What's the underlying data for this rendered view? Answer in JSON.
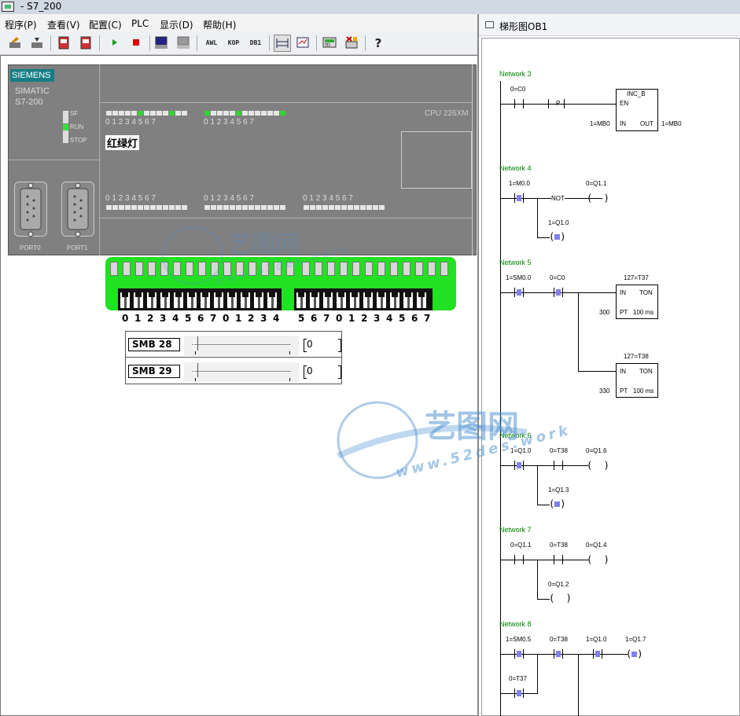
{
  "window": {
    "title": "- S7_200"
  },
  "menu": [
    "程序(P)",
    "查看(V)",
    "配置(C)",
    "PLC",
    "显示(D)",
    "帮助(H)"
  ],
  "toolbar": {
    "awl": "AWL",
    "kop": "KOP",
    "db1": "DB1",
    "help": "?"
  },
  "plc": {
    "brand": "SIEMENS",
    "line1": "SIMATIC",
    "line2": "S7-200",
    "status": [
      "SF",
      "RUN",
      "STOP"
    ],
    "cpu": "CPU 226XM",
    "label": "红绿灯",
    "digits": "0 1 2 3 4 5 6 7",
    "ports": [
      "PORT0",
      "PORT1"
    ]
  },
  "terminal_numbers": [
    "0",
    "1",
    "2",
    "3",
    "4",
    "5",
    "6",
    "7",
    "0",
    "1",
    "2",
    "3",
    "4",
    "5",
    "6",
    "7",
    "0",
    "1",
    "2",
    "3",
    "4",
    "5",
    "6",
    "7"
  ],
  "smb": [
    {
      "label": "SMB 28",
      "value": "0"
    },
    {
      "label": "SMB 29",
      "value": "0"
    }
  ],
  "ladder": {
    "title": "梯形图OB1",
    "networks": [
      {
        "name": "Network 3",
        "labels": [
          "0=C0",
          "P",
          "INC_B",
          "EN",
          "1=MB0",
          "IN",
          "OUT",
          "1=MB0"
        ]
      },
      {
        "name": "Network 4",
        "labels": [
          "1=M0.0",
          "NOT",
          "0=Q1.1",
          "1=Q1.0"
        ]
      },
      {
        "name": "Network 5",
        "labels": [
          "1=SM0.0",
          "0=C0",
          "127=T37",
          "IN",
          "TON",
          "300",
          "PT",
          "100 ms",
          "127=T38",
          "IN",
          "TON",
          "330",
          "PT",
          "100 ms"
        ]
      },
      {
        "name": "Network 6",
        "labels": [
          "1=Q1.0",
          "0=T38",
          "0=Q1.6",
          "1=Q1.3"
        ]
      },
      {
        "name": "Network 7",
        "labels": [
          "0=Q1.1",
          "0=T38",
          "0=Q1.4",
          "0=Q1.2"
        ]
      },
      {
        "name": "Network 8",
        "labels": [
          "1=SM0.5",
          "0=T38",
          "1=Q1.0",
          "1=Q1.7",
          "0=T37"
        ]
      }
    ]
  },
  "watermark": {
    "brand": "艺图网",
    "url": "www.52des.work"
  },
  "colors": {
    "plc_gray": "#808080",
    "terminal_green": "#22e022",
    "led_green": "#39e23a",
    "network_label": "#008000",
    "contact_blue": "#8080ee",
    "siemens_teal": "#157d85"
  }
}
